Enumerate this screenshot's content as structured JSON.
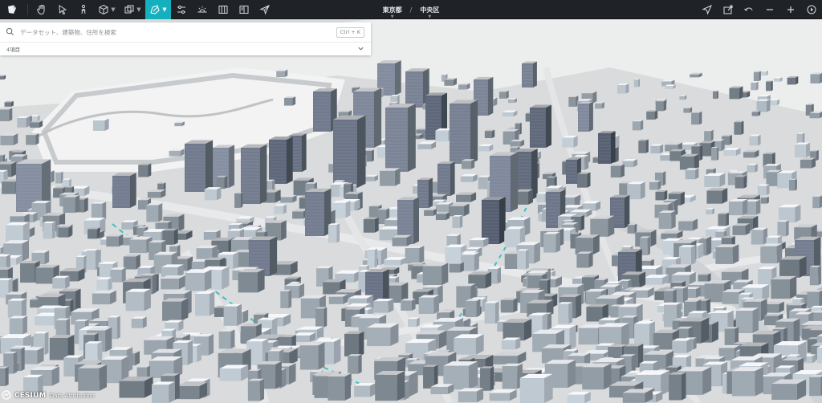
{
  "app": {
    "brand_icon": "app-logo-icon"
  },
  "toolbar": {
    "left_tools": [
      {
        "name": "pan-hand-icon"
      },
      {
        "name": "select-arrow-icon"
      },
      {
        "name": "pedestrian-icon"
      },
      {
        "name": "box-icon",
        "caret": true
      },
      {
        "name": "layers-icon",
        "caret": true
      },
      {
        "name": "draw-shape-icon",
        "caret": true,
        "active": true
      },
      {
        "name": "sliders-icon"
      },
      {
        "name": "sun-horizon-icon"
      },
      {
        "name": "columns-icon"
      },
      {
        "name": "story-icon"
      },
      {
        "name": "send-icon"
      }
    ],
    "right_tools": [
      {
        "name": "navigate-arrow-icon"
      },
      {
        "name": "export-icon"
      },
      {
        "name": "undo-icon"
      },
      {
        "name": "minimize-icon"
      },
      {
        "name": "add-icon"
      },
      {
        "name": "play-icon"
      }
    ],
    "active_color": "#14b0bd"
  },
  "breadcrumb": {
    "prefecture": "東京都",
    "separator": "/",
    "ward": "中央区"
  },
  "search": {
    "placeholder": "データセット、建築物、住所を検索",
    "value": "",
    "shortcut": "Ctrl + K",
    "result_count": "4項目"
  },
  "credit": {
    "logo": "CESIUM",
    "text": "Data Attribution"
  }
}
